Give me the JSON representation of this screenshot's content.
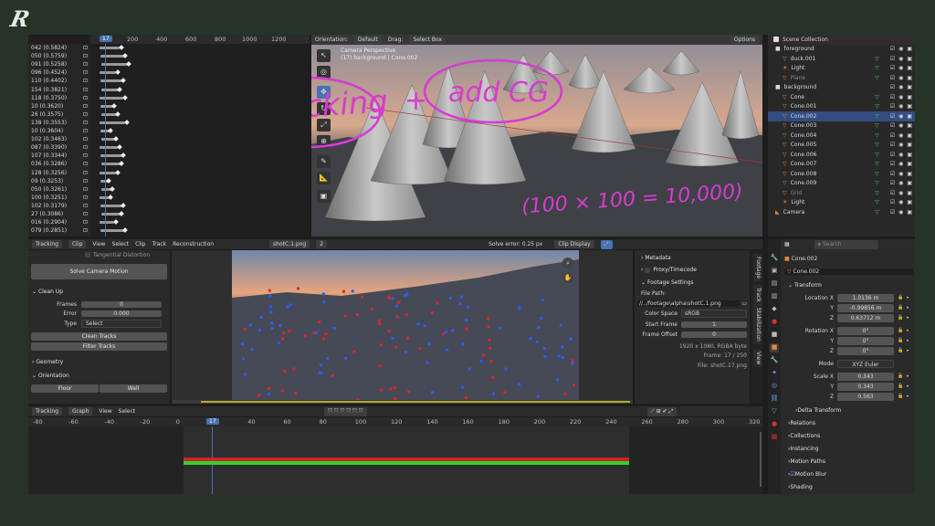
{
  "logos": {
    "top_left": "R",
    "bottom_right": "R"
  },
  "dopesheet": {
    "frame_marker": "17",
    "ruler": [
      "200",
      "400",
      "600",
      "800",
      "1000",
      "1200"
    ],
    "tracks": [
      "042 (0.5824)",
      "050 (0.5759)",
      "091 (0.5258)",
      "096 (0.4524)",
      "110 (0.4402)",
      "154 (0.3821)",
      "118 (0.3750)",
      "10 (0.3620)",
      "26 (0.3575)",
      "138 (0.3553)",
      "10 (0.3604)",
      "102 (0.3463)",
      "087 (0.3390)",
      "107 (0.3344)",
      "036 (0.3286)",
      "128 (0.3256)",
      "09 (0.3253)",
      "050 (0.3261)",
      "100 (0.3251)",
      "102 (0.3179)",
      "27 (0.3086)",
      "016 (0.2904)",
      "079 (0.2851)"
    ]
  },
  "viewport": {
    "orientation_label": "Orientation:",
    "orientation": "Default",
    "drag_label": "Drag:",
    "drag": "Select Box",
    "options": "Options",
    "overlay_line1": "Camera Perspective",
    "overlay_line2": "(17) background | Cone.002"
  },
  "annotations": {
    "tracking": "Tracking",
    "plus": "+",
    "add_cg": "add CG",
    "star": "*",
    "formula": "(100 × 100 = 10,000)"
  },
  "outliner": {
    "root": "Scene Collection",
    "items": [
      {
        "name": "foreground",
        "kind": "coll"
      },
      {
        "name": "duck.001",
        "kind": "obj"
      },
      {
        "name": "Light",
        "kind": "light"
      },
      {
        "name": "Plane",
        "kind": "obj",
        "dim": true
      },
      {
        "name": "background",
        "kind": "coll"
      },
      {
        "name": "Cone",
        "kind": "cone"
      },
      {
        "name": "Cone.001",
        "kind": "cone"
      },
      {
        "name": "Cone.002",
        "kind": "cone",
        "selected": true
      },
      {
        "name": "Cone.003",
        "kind": "cone"
      },
      {
        "name": "Cone.004",
        "kind": "cone"
      },
      {
        "name": "Cone.005",
        "kind": "cone"
      },
      {
        "name": "Cone.006",
        "kind": "cone"
      },
      {
        "name": "Cone.007",
        "kind": "cone"
      },
      {
        "name": "Cone.008",
        "kind": "cone"
      },
      {
        "name": "Cone.009",
        "kind": "cone"
      },
      {
        "name": "Grid",
        "kind": "obj",
        "dim": true
      },
      {
        "name": "Light",
        "kind": "light"
      },
      {
        "name": "Camera",
        "kind": "cam"
      }
    ]
  },
  "clip": {
    "mode": "Tracking",
    "clip_btn": "Clip",
    "menus": [
      "View",
      "Select",
      "Clip",
      "Track",
      "Reconstruction"
    ],
    "file": "shotC.1.png",
    "file_num": "2",
    "solve_error": "Solve error: 0.25 px",
    "display": "Clip Display",
    "tangential": "Tangential Distortion",
    "solve_btn": "Solve Camera Motion",
    "cleanup": {
      "title": "Clean Up",
      "frames_label": "Frames",
      "frames": "0",
      "error_label": "Error",
      "error": "0.000",
      "type_label": "Type",
      "type": "Select",
      "clean_btn": "Clean Tracks",
      "filter_btn": "Filter Tracks"
    },
    "geometry": "Geometry",
    "orientation": "Orientation",
    "floor": "Floor",
    "wall": "Wall"
  },
  "footage": {
    "metadata": "Metadata",
    "proxy": "Proxy/Timecode",
    "settings": "Footage Settings",
    "file_path_label": "File Path:",
    "file_path": "//../footage\\alpha\\shotC.1.png",
    "color_space_label": "Color Space",
    "color_space": "sRGB",
    "start_frame_label": "Start Frame",
    "start_frame": "1",
    "frame_offset_label": "Frame Offset",
    "frame_offset": "0",
    "info1": "1920 x 1080, RGBA byte",
    "info2": "Frame: 17 / 250",
    "info3": "File: shotC.17.png",
    "vtabs": [
      "Footage",
      "Track",
      "Stabilization",
      "View"
    ]
  },
  "graph": {
    "mode": "Tracking",
    "view": "Graph",
    "menus": [
      "View",
      "Select"
    ],
    "ticks": [
      "-80",
      "-60",
      "-40",
      "-20",
      "0",
      "20",
      "40",
      "60",
      "80",
      "100",
      "120",
      "140",
      "160",
      "180",
      "200",
      "220",
      "240",
      "260",
      "280",
      "300",
      "320"
    ],
    "current": "17"
  },
  "properties": {
    "search": "Search",
    "object": "Cone.002",
    "data": "Cone.002",
    "transform": "Transform",
    "location_label": "Location X",
    "loc": [
      "1.0136 m",
      "-0.99856 m",
      "0.63712 m"
    ],
    "rotation_label": "Rotation X",
    "rot": [
      "0°",
      "0°",
      "0°"
    ],
    "mode_label": "Mode",
    "mode": "XYZ Euler",
    "scale_label": "Scale X",
    "scale": [
      "0.343",
      "0.343",
      "0.563"
    ],
    "axes": [
      "Y",
      "Z"
    ],
    "sections": [
      "Delta Transform",
      "Relations",
      "Collections",
      "Instancing",
      "Motion Paths",
      "Motion Blur",
      "Shading"
    ]
  },
  "colors": {
    "track_red": "#e0242a",
    "track_green": "#33d12a",
    "frame_blue": "#4772b3",
    "annotation": "#d63cd0"
  }
}
